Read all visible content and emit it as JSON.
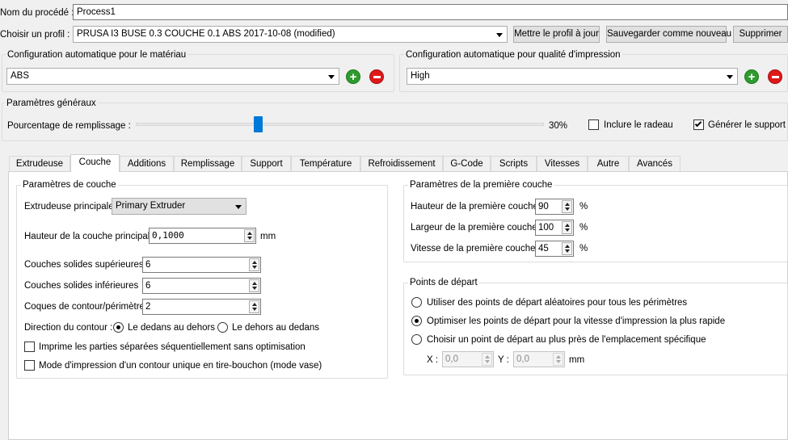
{
  "top": {
    "procedure_name_label": "Nom du procédé :",
    "procedure_name_value": "Process1",
    "profile_label": "Choisir un profil :",
    "profile_value": "PRUSA I3 BUSE 0.3 COUCHE 0.1 ABS 2017-10-08 (modified)",
    "update_profile_button": "Mettre le profil à jour",
    "save_new_button": "Sauvegarder comme nouveau",
    "delete_button": "Supprimer"
  },
  "material": {
    "title": "Configuration automatique pour le matériau",
    "value": "ABS"
  },
  "quality": {
    "title": "Configuration automatique pour qualité d'impression",
    "value": "High"
  },
  "general": {
    "title": "Paramètres généraux",
    "infill_label": "Pourcentage de remplissage :",
    "infill_value": "30%",
    "infill_fraction": 0.3,
    "raft_label": "Inclure le radeau",
    "raft_checked": false,
    "support_label": "Générer le support",
    "support_checked": true
  },
  "tabs": [
    "Extrudeuse",
    "Couche",
    "Additions",
    "Remplissage",
    "Support",
    "Température",
    "Refroidissement",
    "G-Code",
    "Scripts",
    "Vitesses",
    "Autre",
    "Avancés"
  ],
  "active_tab": "Couche",
  "layer": {
    "title": "Paramètres de couche",
    "main_extruder_label": "Extrudeuse principale",
    "main_extruder_value": "Primary Extruder",
    "layer_height_label": "Hauteur de la couche principale",
    "layer_height_value": "0,1000",
    "layer_height_unit": "mm",
    "top_solid_label": "Couches solides supérieures",
    "top_solid_value": "6",
    "bottom_solid_label": "Couches solides inférieures",
    "bottom_solid_value": "6",
    "perimeter_label": "Coques de contour/périmètre",
    "perimeter_value": "2",
    "direction_label": "Direction du contour :",
    "direction_inside_out": "Le dedans au dehors",
    "direction_outside_in": "Le dehors au dedans",
    "sequential_label": "Imprime les parties séparées séquentiellement sans optimisation",
    "vase_label": "Mode d'impression d'un contour unique en tire-bouchon (mode vase)"
  },
  "first_layer": {
    "title": "Paramètres de la première couche",
    "height_label": "Hauteur de la première couche",
    "height_value": "90",
    "width_label": "Largeur de la première couche",
    "width_value": "100",
    "speed_label": "Vitesse de la première couche",
    "speed_value": "45",
    "unit": "%"
  },
  "start_points": {
    "title": "Points de départ",
    "random_label": "Utiliser des points de départ aléatoires pour tous les périmètres",
    "optimize_label": "Optimiser les points de départ pour la vitesse d'impression la plus rapide",
    "specific_label": "Choisir un point de départ au plus près de l'emplacement spécifique",
    "x_label": "X :",
    "x_value": "0,0",
    "y_label": "Y :",
    "y_value": "0,0",
    "unit": "mm"
  }
}
